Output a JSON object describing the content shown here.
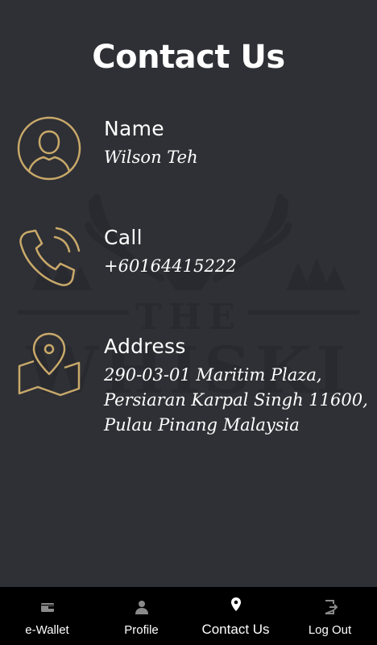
{
  "page": {
    "title": "Contact Us"
  },
  "watermark": {
    "line1": "THE",
    "line2": "WHISKI"
  },
  "contacts": [
    {
      "icon": "user-icon",
      "label": "Name",
      "value": "Wilson Teh"
    },
    {
      "icon": "phone-icon",
      "label": "Call",
      "value": "+60164415222"
    },
    {
      "icon": "map-pin-icon",
      "label": "Address",
      "lines": [
        "290-03-01 Maritim Plaza,",
        "Persiaran Karpal Singh 11600,",
        "Pulau Pinang Malaysia"
      ]
    }
  ],
  "nav": {
    "items": [
      {
        "label": "e-Wallet",
        "icon": "wallet-icon",
        "active": false
      },
      {
        "label": "Profile",
        "icon": "person-icon",
        "active": false
      },
      {
        "label": "Contact Us",
        "icon": "location-icon",
        "active": true
      },
      {
        "label": "Log Out",
        "icon": "logout-icon",
        "active": false
      }
    ]
  },
  "colors": {
    "background": "#2f3035",
    "accent_gold": "#c9a96a",
    "nav_background": "#000000",
    "nav_icon_inactive": "#8a8a8a",
    "text": "#ffffff"
  }
}
